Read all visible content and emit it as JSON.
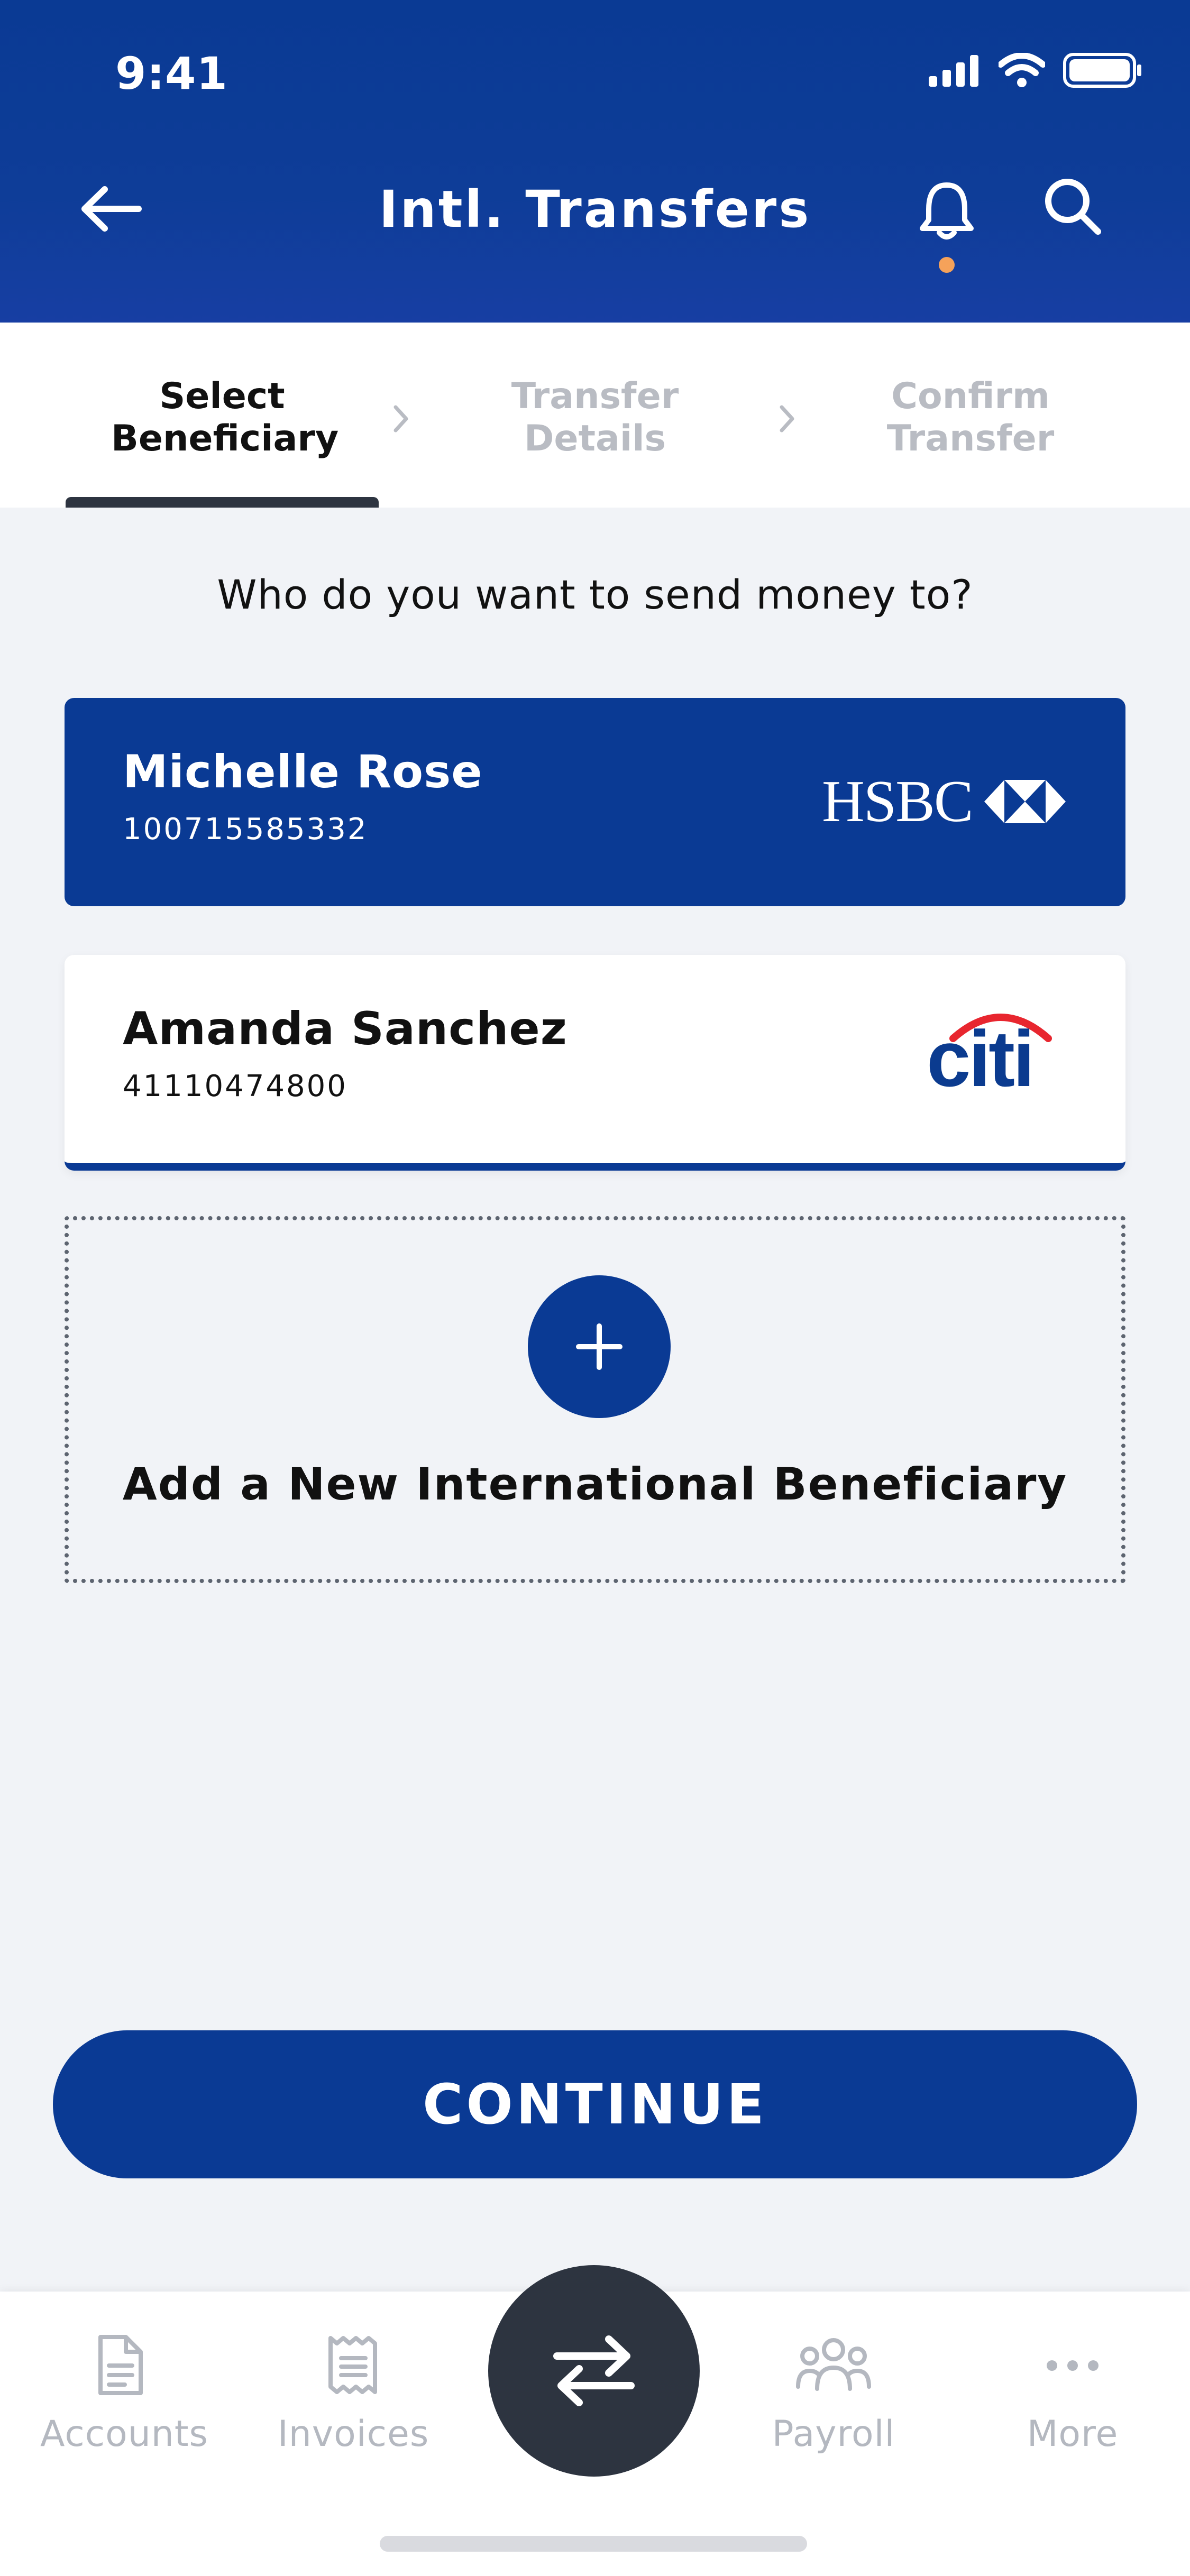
{
  "status_bar": {
    "time": "9:41"
  },
  "header": {
    "title": "Intl. Transfers"
  },
  "stepper": {
    "steps": [
      {
        "line1": "Select",
        "line2": "Beneficiary"
      },
      {
        "line1": "Transfer",
        "line2": "Details"
      },
      {
        "line1": "Confirm",
        "line2": "Transfer"
      }
    ],
    "active_step": 1
  },
  "prompt": "Who do you want to send money to?",
  "beneficiaries": [
    {
      "name": "Michelle Rose",
      "account": "100715585332",
      "bank": "HSBC",
      "selected": true
    },
    {
      "name": "Amanda Sanchez",
      "account": "41110474800",
      "bank": "citi",
      "selected": false
    }
  ],
  "add_beneficiary": {
    "label": "Add a New International Beneficiary"
  },
  "continue_label": "CONTINUE",
  "tabbar": {
    "items": [
      {
        "label": "Accounts",
        "icon": "document-icon"
      },
      {
        "label": "Invoices",
        "icon": "receipt-icon"
      },
      {
        "label": "",
        "icon": "transfer-arrows-icon"
      },
      {
        "label": "Payroll",
        "icon": "people-icon"
      },
      {
        "label": "More",
        "icon": "more-dots-icon"
      }
    ]
  },
  "colors": {
    "primary": "#0a3a94",
    "fab": "#2d3440",
    "notification_dot": "#f5a25a",
    "citi_red": "#e8262f",
    "citi_blue": "#0b3b8f",
    "hsbc_red": "#db0011"
  }
}
